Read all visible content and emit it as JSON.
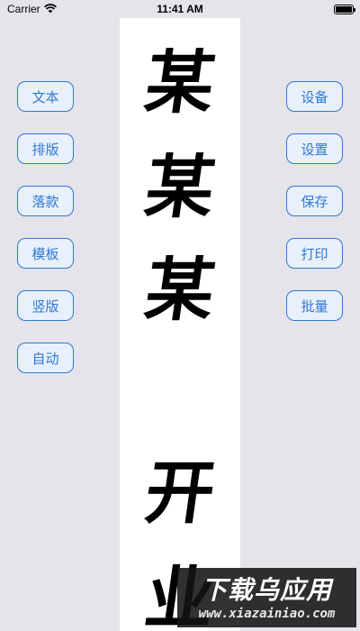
{
  "status_bar": {
    "carrier": "Carrier",
    "time": "11:41 AM"
  },
  "paper": {
    "characters": [
      "某",
      "某",
      "某",
      "开",
      "业"
    ]
  },
  "left_buttons": [
    "文本",
    "排版",
    "落款",
    "模板",
    "竖版",
    "自动"
  ],
  "right_buttons": [
    "设备",
    "设置",
    "保存",
    "打印",
    "批量"
  ],
  "watermark": {
    "title": "下载乌应用",
    "subtitle": "www.xiazainiao.com"
  },
  "colors": {
    "background": "#e4e4ea",
    "accent": "#2f78d4",
    "button_fill": "#e8f0fb",
    "paper": "#ffffff"
  }
}
